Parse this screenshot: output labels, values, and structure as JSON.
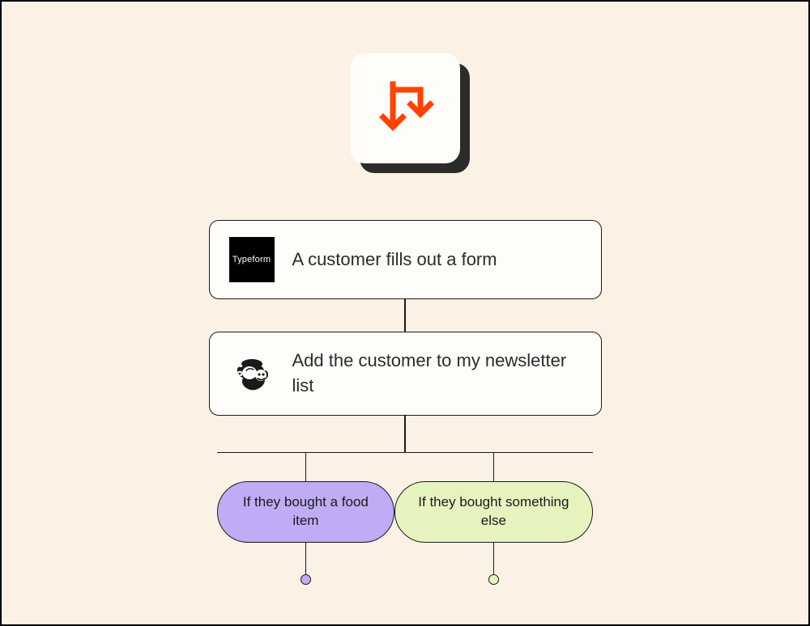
{
  "steps": [
    {
      "service": "Typeform",
      "logo_text": "Typeform",
      "description": "A customer fills out a form"
    },
    {
      "service": "Mailchimp",
      "description": "Add the customer to my newsletter list"
    }
  ],
  "branches": [
    {
      "label": "If they bought a food item",
      "color": "purple"
    },
    {
      "label": "If they bought something else",
      "color": "green"
    }
  ]
}
